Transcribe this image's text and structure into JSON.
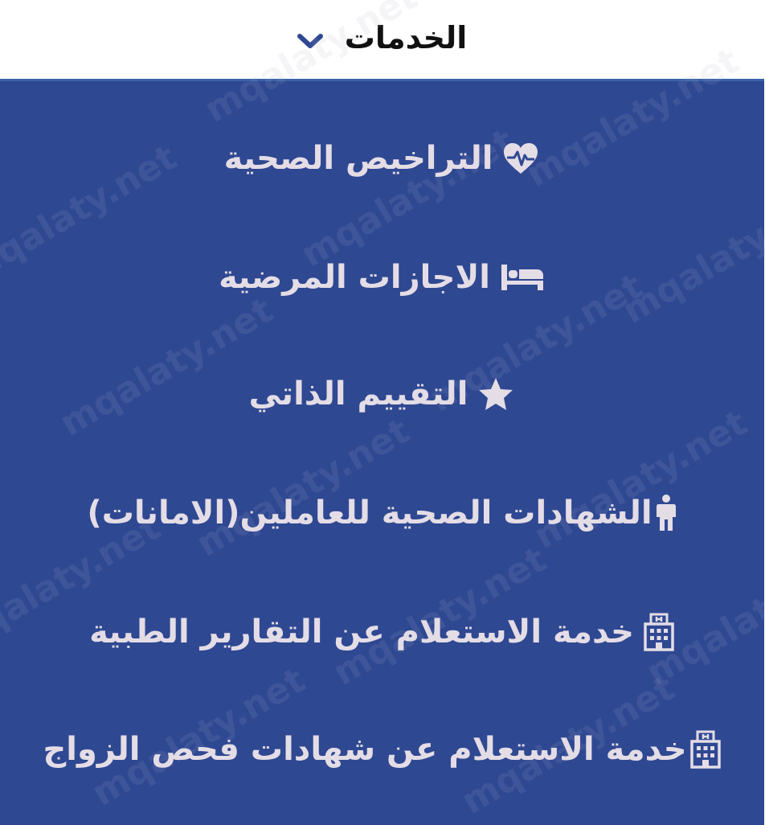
{
  "header": {
    "title": "الخدمات"
  },
  "menu": {
    "items": [
      {
        "label": "التراخيص الصحية",
        "icon": "heartbeat-icon"
      },
      {
        "label": "الاجازات المرضية",
        "icon": "bed-icon"
      },
      {
        "label": "التقييم الذاتي",
        "icon": "star-icon"
      },
      {
        "label": "الشهادات الصحية للعاملين(الامانات)",
        "icon": "person-icon"
      },
      {
        "label": "خدمة الاستعلام عن التقارير الطبية",
        "icon": "hospital-icon"
      },
      {
        "label": "خدمة الاستعلام عن شهادات فحص الزواج",
        "icon": "hospital-icon"
      }
    ]
  },
  "watermark": {
    "text": "mqalaty.net"
  },
  "colors": {
    "panel_bg": "#2f4892",
    "item_text": "#e4dde6",
    "header_text": "#111111",
    "chevron": "#2f4892",
    "header_border": "#3a63a8"
  }
}
